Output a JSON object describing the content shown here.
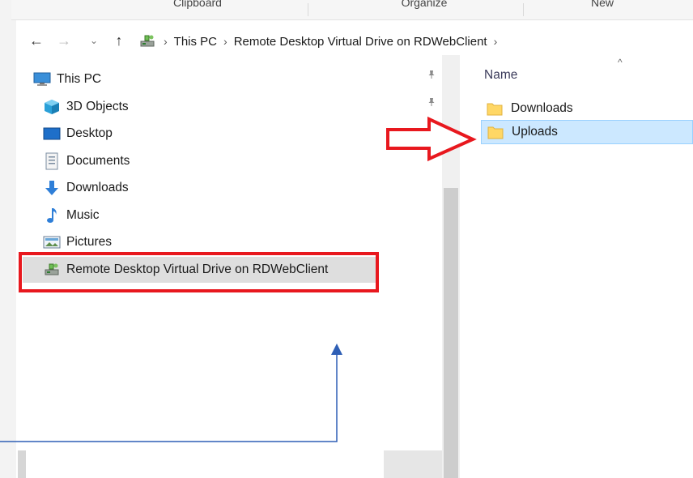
{
  "ribbon": {
    "groups": [
      "Clipboard",
      "Organize",
      "New"
    ]
  },
  "navbar": {
    "back_glyph": "←",
    "forward_glyph": "→",
    "recent_glyph": "⌄",
    "up_glyph": "↑",
    "path": [
      "This PC",
      "Remote Desktop Virtual Drive on RDWebClient"
    ],
    "chevron": "›"
  },
  "tree": {
    "items": [
      {
        "label": "This PC",
        "icon": "computer-icon"
      },
      {
        "label": "3D Objects",
        "icon": "3d-objects-icon"
      },
      {
        "label": "Desktop",
        "icon": "desktop-icon"
      },
      {
        "label": "Documents",
        "icon": "documents-icon"
      },
      {
        "label": "Downloads",
        "icon": "downloads-icon"
      },
      {
        "label": "Music",
        "icon": "music-icon"
      },
      {
        "label": "Pictures",
        "icon": "pictures-icon"
      },
      {
        "label": "Remote Desktop Virtual Drive on RDWebClient",
        "icon": "network-drive-icon"
      }
    ],
    "pin_glyph": "📌"
  },
  "content": {
    "column_header": "Name",
    "sort_caret": "^",
    "files": [
      {
        "name": "Downloads",
        "icon": "folder-icon"
      },
      {
        "name": "Uploads",
        "icon": "folder-icon",
        "selected": true
      }
    ]
  },
  "colors": {
    "accent_red": "#e8181e",
    "annotation_blue": "#2f5fb5",
    "selection_blue": "#cce8ff",
    "folder_yellow": "#ffd765"
  }
}
